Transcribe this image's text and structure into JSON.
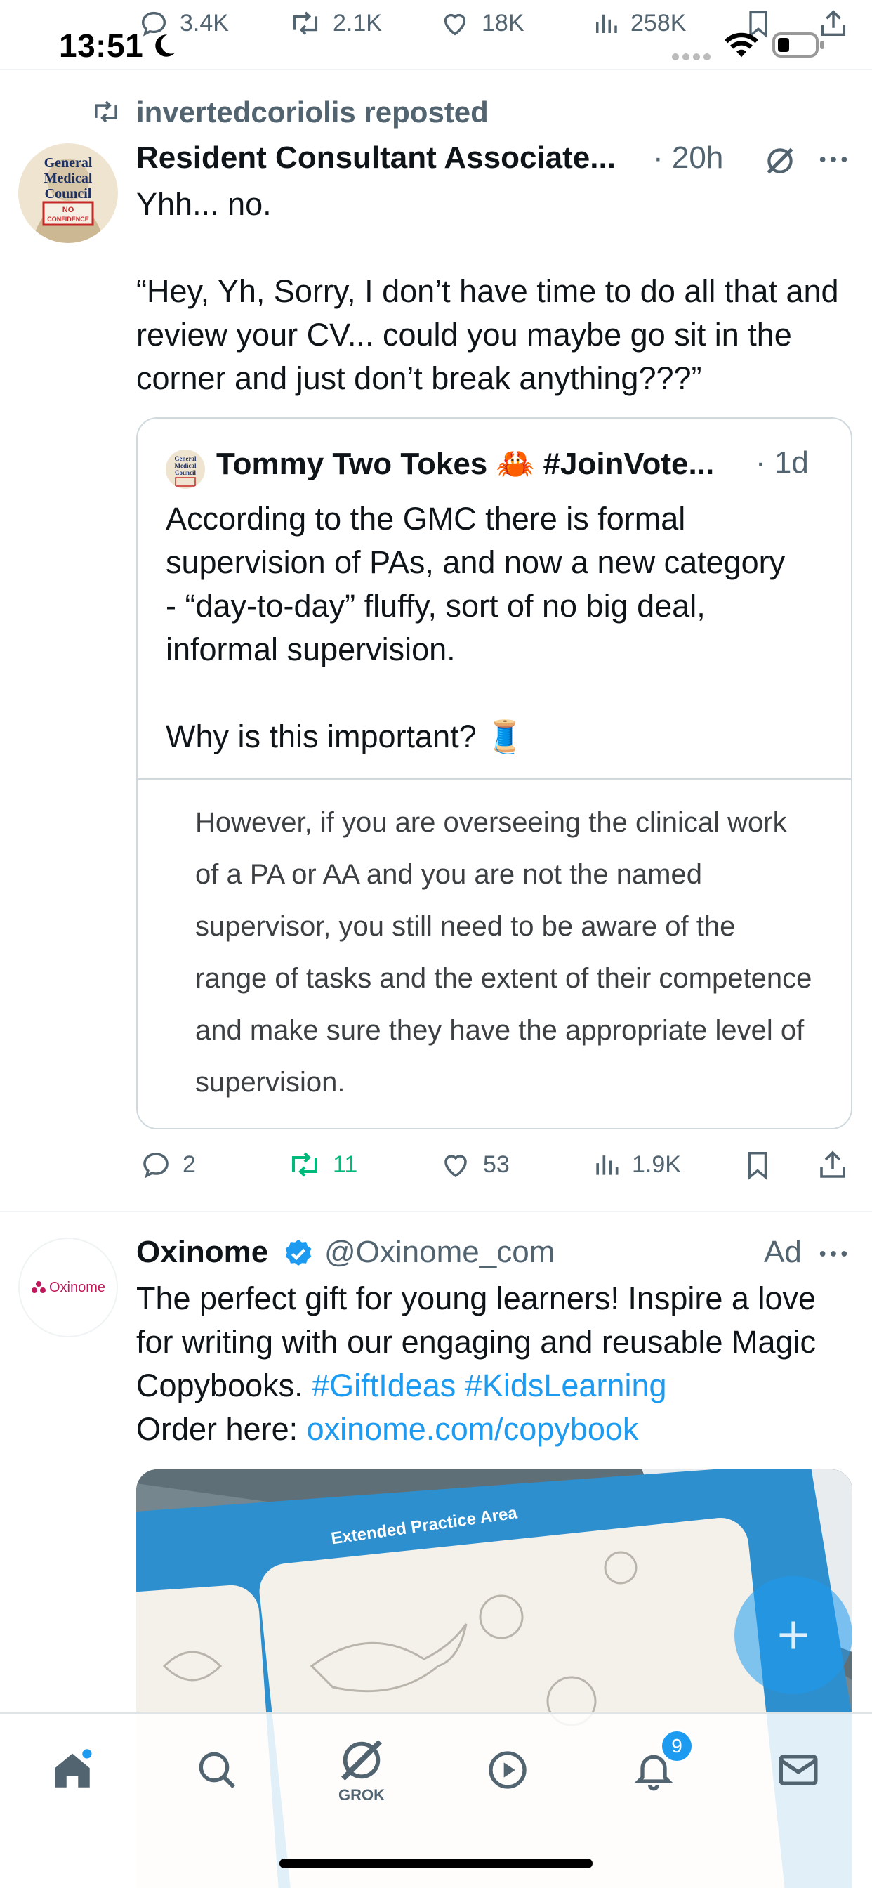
{
  "status_bar": {
    "time": "13:51"
  },
  "top_actions": {
    "replies": "3.4K",
    "reposts": "2.1K",
    "likes": "18K",
    "views": "258K"
  },
  "tweet1": {
    "repost_label": "invertedcoriolis reposted",
    "author_name": "Resident Consultant Associate...",
    "time": "20h",
    "avatar_text": [
      "General",
      "Medical",
      "Council",
      "NO",
      "CONFIDENCE"
    ],
    "text_line1": "Yhh... no.",
    "text_line2": "“Hey, Yh, Sorry, I don’t have time to do all that and review your CV... could you maybe go sit in the corner and just don’t break anything???”",
    "quote": {
      "author_name": "Tommy Two Tokes 🦀 #JoinVote...",
      "time": "1d",
      "text_p1": "According to the GMC there is formal supervision of PAs, and now a new category - “day-to-day” fluffy, sort of no big deal, informal supervision.",
      "text_p2": "Why is this important? 🧵",
      "image_text": "However, if you are overseeing the clinical work of a PA or AA and you are not the named supervisor, you still need to be aware of the range of tasks and the extent of their competence and make sure they have the appropriate level of supervision."
    },
    "actions": {
      "replies": "2",
      "reposts": "11",
      "likes": "53",
      "views": "1.9K"
    }
  },
  "tweet2": {
    "author_name": "Oxinome",
    "handle": "@Oxinome_com",
    "ad_label": "Ad",
    "avatar_text": "Oxinome",
    "text_plain": "The perfect gift for young learners! Inspire a love for writing with our engaging and reusable Magic Copybooks.",
    "hashtag1": "#GiftIdeas",
    "hashtag2": "#KidsLearning",
    "order_label": "Order here:",
    "link": "oxinome.com/copybook",
    "image_banner": "Extended Practice Area"
  },
  "bottom_nav": {
    "grok_label": "GROK",
    "notifications_badge": "9"
  },
  "colors": {
    "accent": "#1d9bf0",
    "repost_green": "#00ba7c",
    "secondary_text": "#536471",
    "border": "#cfd9de",
    "oxinome_brand": "#c2185b"
  }
}
